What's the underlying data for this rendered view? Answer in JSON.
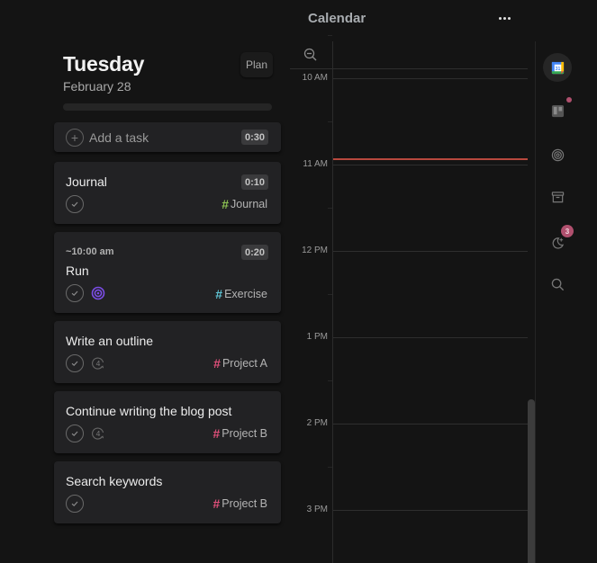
{
  "day": {
    "weekday": "Tuesday",
    "date": "February 28",
    "plan_label": "Plan",
    "progress": 0
  },
  "add_task": {
    "placeholder": "Add a task",
    "duration": "0:30"
  },
  "tasks": [
    {
      "title": "Journal",
      "duration": "0:10",
      "time": "",
      "tag": "Journal",
      "tag_color": "#8cc152",
      "extra_icon": ""
    },
    {
      "title": "Run",
      "duration": "0:20",
      "time": "~10:00 am",
      "tag": "Exercise",
      "tag_color": "#5fc6d6",
      "extra_icon": "target-icon"
    },
    {
      "title": "Write an outline",
      "duration": "",
      "time": "",
      "tag": "Project A",
      "tag_color": "#e0507a",
      "extra_icon": "subtasks-count-icon",
      "extra_value": "4"
    },
    {
      "title": "Continue writing the blog post",
      "duration": "",
      "time": "",
      "tag": "Project B",
      "tag_color": "#e0507a",
      "extra_icon": "subtasks-count-icon",
      "extra_value": "4"
    },
    {
      "title": "Search keywords",
      "duration": "",
      "time": "",
      "tag": "Project B",
      "tag_color": "#e0507a",
      "extra_icon": ""
    }
  ],
  "calendar": {
    "title": "Calendar",
    "more_icon": "ellipsis-icon",
    "zoom_icon": "zoom-out-icon",
    "hours": [
      "10 AM",
      "11 AM",
      "12 PM",
      "1 PM",
      "2 PM",
      "3 PM"
    ],
    "now_color": "#b8483e"
  },
  "rail": {
    "items": [
      {
        "name": "google-calendar",
        "active": true
      },
      {
        "name": "trello",
        "badge_dot": true
      },
      {
        "name": "focus-target"
      },
      {
        "name": "archive"
      },
      {
        "name": "night-mode",
        "badge_count": "3"
      },
      {
        "name": "search"
      }
    ],
    "badge_color": "#b0506e"
  }
}
